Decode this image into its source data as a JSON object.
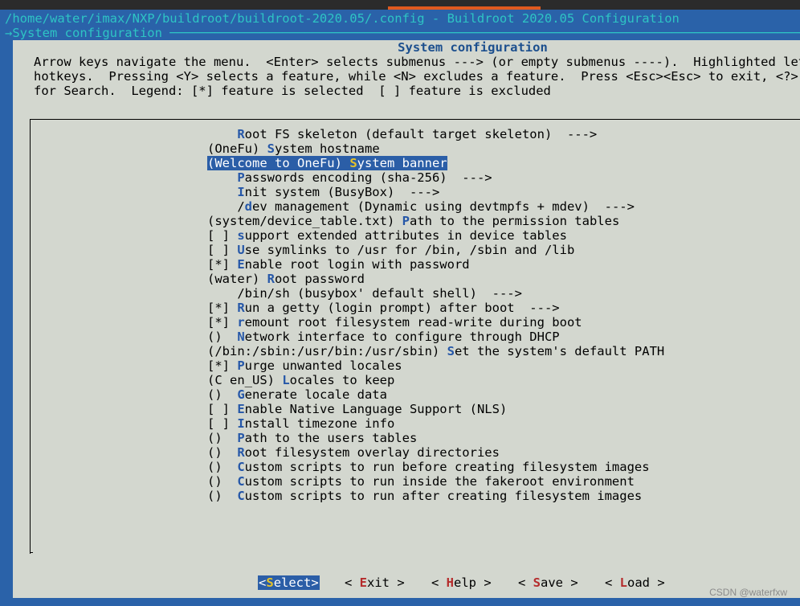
{
  "terminal": {
    "title": "/home/water/imax/NXP/buildroot/buildroot-2020.05/.config - Buildroot 2020.05 Configuration",
    "path": "→System configuration ─────────────────────────────────────────────────────────────────────────────────────────"
  },
  "dialog": {
    "title": "System configuration",
    "help": [
      "Arrow keys navigate the menu.  <Enter> selects submenus ---> (or empty submenus ----).  Highlighted letters are",
      "hotkeys.  Pressing <Y> selects a feature, while <N> excludes a feature.  Press <Esc><Esc> to exit, <?> for Help, </>",
      "for Search.  Legend: [*] feature is selected  [ ] feature is excluded"
    ]
  },
  "menu": {
    "items": [
      {
        "prefix": "    ",
        "hotkey": "R",
        "rest": "oot FS skeleton (default target skeleton)  --->"
      },
      {
        "prefix": "(OneFu) ",
        "hotkey": "S",
        "rest": "ystem hostname"
      },
      {
        "prefix": "(Welcome to OneFu) ",
        "hotkey": "S",
        "rest": "ystem banner",
        "selected": true
      },
      {
        "prefix": "    ",
        "hotkey": "P",
        "rest": "asswords encoding (sha-256)  --->"
      },
      {
        "prefix": "    ",
        "hotkey": "I",
        "rest": "nit system (BusyBox)  --->"
      },
      {
        "prefix": "    /",
        "hotkey": "d",
        "rest": "ev management (Dynamic using devtmpfs + mdev)  --->"
      },
      {
        "prefix": "(system/device_table.txt) ",
        "hotkey": "P",
        "rest": "ath to the permission tables"
      },
      {
        "prefix": "[ ] ",
        "hotkey": "s",
        "rest": "upport extended attributes in device tables"
      },
      {
        "prefix": "[ ] ",
        "hotkey": "U",
        "rest": "se symlinks to /usr for /bin, /sbin and /lib"
      },
      {
        "prefix": "[*] ",
        "hotkey": "E",
        "rest": "nable root login with password"
      },
      {
        "prefix": "(water) ",
        "hotkey": "R",
        "rest": "oot password"
      },
      {
        "prefix": "    /bin/sh (busybox' default shell)  --->",
        "hotkey": "",
        "rest": ""
      },
      {
        "prefix": "[*] ",
        "hotkey": "R",
        "rest": "un a getty (login prompt) after boot  --->"
      },
      {
        "prefix": "[*] ",
        "hotkey": "r",
        "rest": "emount root filesystem read-write during boot"
      },
      {
        "prefix": "()  ",
        "hotkey": "N",
        "rest": "etwork interface to configure through DHCP"
      },
      {
        "prefix": "(/bin:/sbin:/usr/bin:/usr/sbin) ",
        "hotkey": "S",
        "rest": "et the system's default PATH"
      },
      {
        "prefix": "[*] ",
        "hotkey": "P",
        "rest": "urge unwanted locales"
      },
      {
        "prefix": "(C en_US) ",
        "hotkey": "L",
        "rest": "ocales to keep"
      },
      {
        "prefix": "()  ",
        "hotkey": "G",
        "rest": "enerate locale data"
      },
      {
        "prefix": "[ ] ",
        "hotkey": "E",
        "rest": "nable Native Language Support (NLS)"
      },
      {
        "prefix": "[ ] ",
        "hotkey": "I",
        "rest": "nstall timezone info"
      },
      {
        "prefix": "()  ",
        "hotkey": "P",
        "rest": "ath to the users tables"
      },
      {
        "prefix": "()  ",
        "hotkey": "R",
        "rest": "oot filesystem overlay directories"
      },
      {
        "prefix": "()  ",
        "hotkey": "C",
        "rest": "ustom scripts to run before creating filesystem images"
      },
      {
        "prefix": "()  ",
        "hotkey": "C",
        "rest": "ustom scripts to run inside the fakeroot environment"
      },
      {
        "prefix": "()  ",
        "hotkey": "C",
        "rest": "ustom scripts to run after creating filesystem images"
      }
    ]
  },
  "buttons": [
    {
      "name": "select-button",
      "open": "<",
      "hotkey": "S",
      "rest": "elect",
      "close": ">",
      "selected": true
    },
    {
      "name": "exit-button",
      "open": "< ",
      "hotkey": "E",
      "rest": "xit",
      "close": " >"
    },
    {
      "name": "help-button",
      "open": "< ",
      "hotkey": "H",
      "rest": "elp",
      "close": " >"
    },
    {
      "name": "save-button",
      "open": "< ",
      "hotkey": "S",
      "rest": "ave",
      "close": " >"
    },
    {
      "name": "load-button",
      "open": "< ",
      "hotkey": "L",
      "rest": "oad",
      "close": " >"
    }
  ],
  "watermark": "CSDN @waterfxw",
  "colors": {
    "background": "#2a62a9",
    "dialog": "#d3d7cf",
    "hotkey": "#2557a8",
    "highlight": "#2b5ea7",
    "highlight_hotkey": "#e6c32a",
    "button_hotkey": "#b52b2b",
    "terminal_text": "#2ec4c4"
  }
}
